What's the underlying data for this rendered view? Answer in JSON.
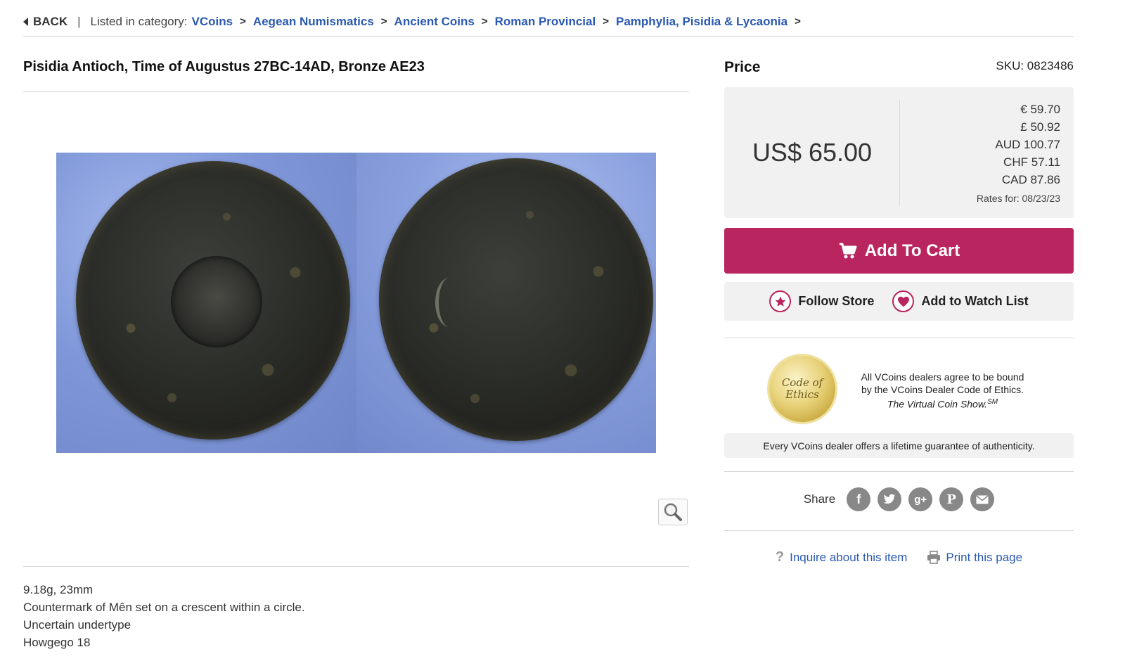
{
  "breadcrumb": {
    "back_label": "BACK",
    "separator": "|",
    "listed_label": "Listed in category:",
    "items": [
      "VCoins",
      "Aegean Numismatics",
      "Ancient Coins",
      "Roman Provincial",
      "Pamphylia, Pisidia & Lycaonia"
    ],
    "arrow": ">"
  },
  "item": {
    "title": "Pisidia Antioch, Time of Augustus 27BC-14AD, Bronze AE23",
    "description": [
      "9.18g, 23mm",
      "Countermark of Mên set on a crescent within a circle.",
      "Uncertain undertype",
      "Howgego 18"
    ],
    "zoom_icon": "magnifier-icon"
  },
  "price": {
    "label": "Price",
    "sku": "SKU: 0823486",
    "main": "US$ 65.00",
    "conversions": [
      "€ 59.70",
      "£ 50.92",
      "AUD 100.77",
      "CHF 57.11",
      "CAD 87.86"
    ],
    "rates_date": "Rates for: 08/23/23"
  },
  "actions": {
    "add_to_cart": "Add To Cart",
    "follow_store": "Follow Store",
    "watch_list": "Add to Watch List"
  },
  "ethics": {
    "seal_line1": "Code of",
    "seal_line2": "Ethics",
    "line1": "All VCoins dealers agree to be bound",
    "line2": "by the VCoins Dealer Code of Ethics.",
    "line3": "The Virtual Coin Show.",
    "sm": "SM",
    "guarantee": "Every VCoins dealer offers a lifetime guarantee of authenticity."
  },
  "share": {
    "label": "Share",
    "icons": [
      "facebook-icon",
      "twitter-icon",
      "google-plus-icon",
      "pinterest-icon",
      "email-icon"
    ]
  },
  "links": {
    "inquire": "Inquire about this item",
    "print": "Print this page"
  },
  "colors": {
    "link_blue": "#2a59b0",
    "cart_magenta": "#b9255e",
    "panel_gray": "#f1f1f1"
  }
}
